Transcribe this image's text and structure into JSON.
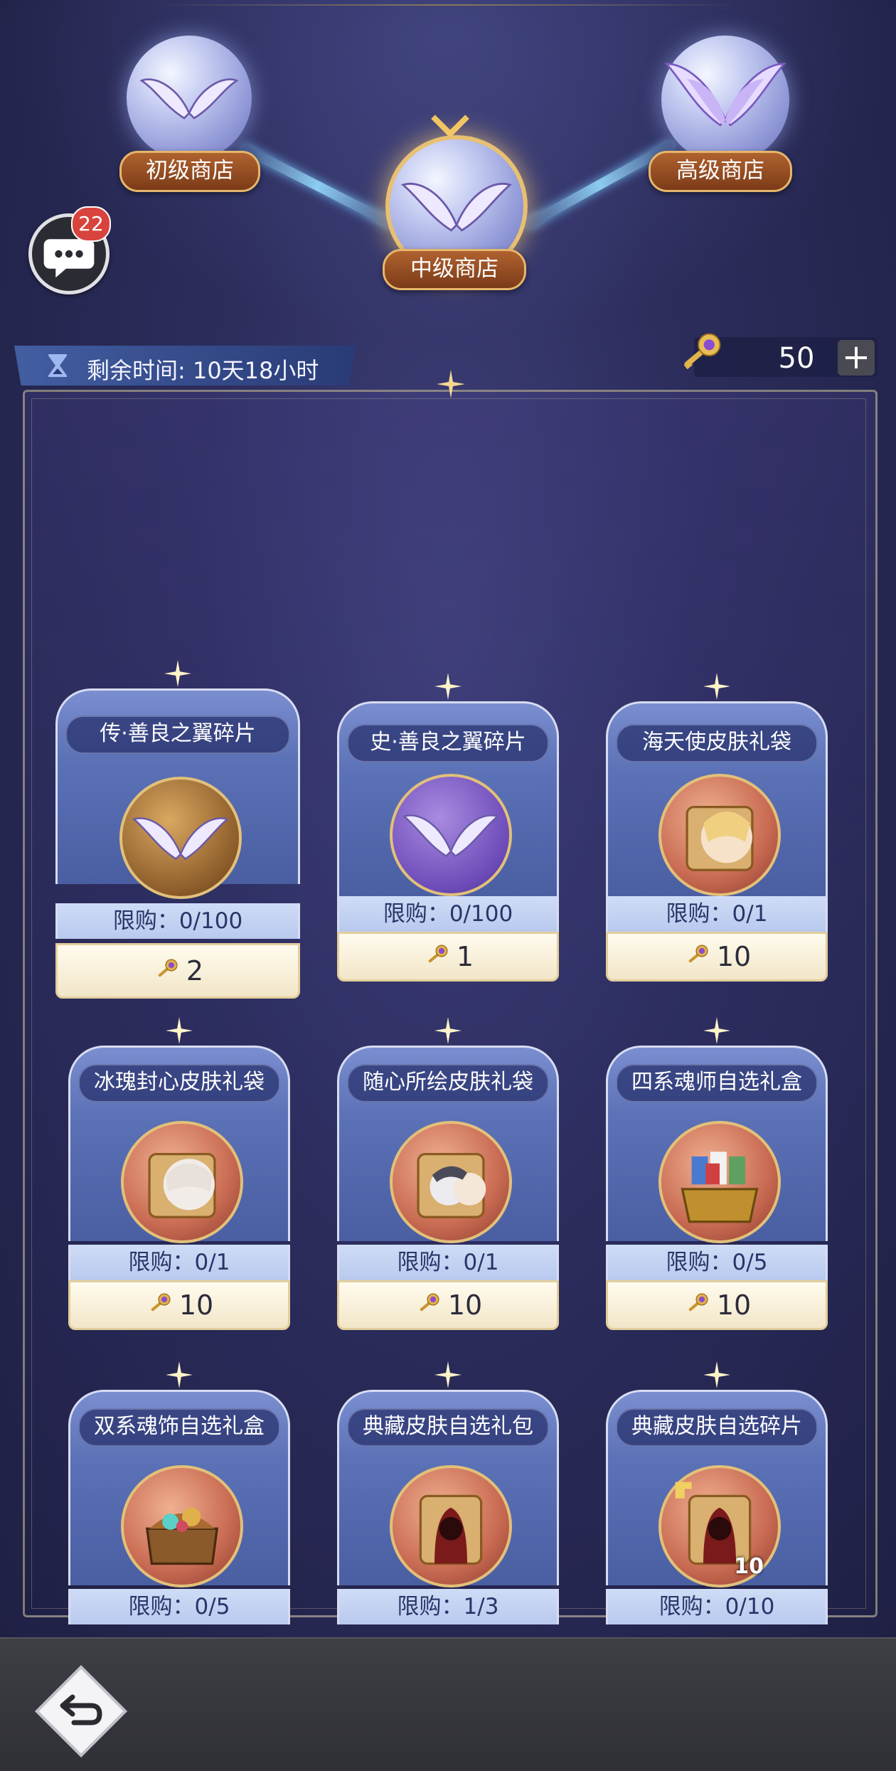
{
  "tiers": [
    {
      "label": "初级商店"
    },
    {
      "label": "中级商店"
    },
    {
      "label": "高级商店"
    }
  ],
  "chat": {
    "badge": "22"
  },
  "timer": {
    "text": "剩余时间: 10天18小时"
  },
  "currency": {
    "count": "50",
    "plus": "+"
  },
  "cards": [
    {
      "name": "传·善良之翼碎片",
      "limit": "限购：0/100",
      "price": "2"
    },
    {
      "name": "史·善良之翼碎片",
      "limit": "限购：0/100",
      "price": "1"
    },
    {
      "name": "海天使皮肤礼袋",
      "limit": "限购：0/1",
      "price": "10"
    },
    {
      "name": "冰瑰封心皮肤礼袋",
      "limit": "限购：0/1",
      "price": "10"
    },
    {
      "name": "随心所绘皮肤礼袋",
      "limit": "限购：0/1",
      "price": "10"
    },
    {
      "name": "四系魂师自选礼盒",
      "limit": "限购：0/5",
      "price": "10"
    },
    {
      "name": "双系魂饰自选礼盒",
      "limit": "限购：0/5",
      "price": ""
    },
    {
      "name": "典藏皮肤自选礼包",
      "limit": "限购：1/3",
      "price": ""
    },
    {
      "name": "典藏皮肤自选碎片",
      "limit": "限购：0/10",
      "price": "",
      "icon_count": "10"
    }
  ],
  "colors": {
    "accent_gold": "#e7c072",
    "badge_red": "#d8443d",
    "card_blue": "#5c72b6"
  }
}
